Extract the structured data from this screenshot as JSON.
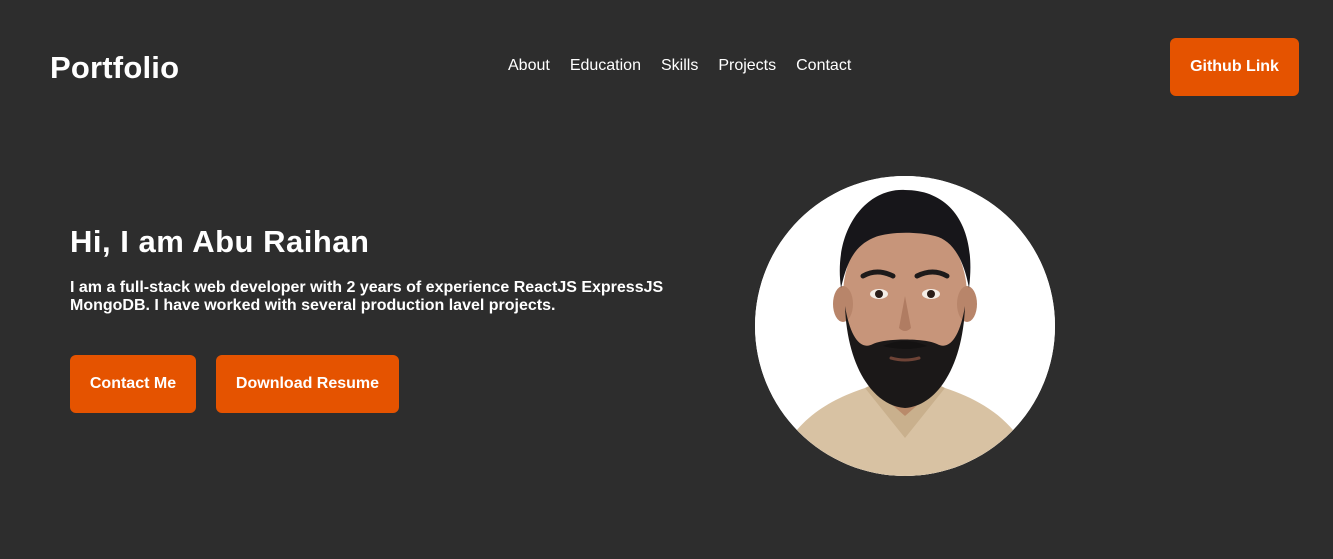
{
  "header": {
    "brand": "Portfolio",
    "nav": [
      {
        "label": "About"
      },
      {
        "label": "Education"
      },
      {
        "label": "Skills"
      },
      {
        "label": "Projects"
      },
      {
        "label": "Contact"
      }
    ],
    "github_label": "Github Link"
  },
  "hero": {
    "title": "Hi, I am Abu Raihan",
    "description": "I am a full-stack web developer with 2 years of experience ReactJS ExpressJS MongoDB. I have worked with several production lavel projects.",
    "contact_label": "Contact Me",
    "resume_label": "Download Resume"
  },
  "profile_photo": {
    "shape": "circle"
  },
  "colors": {
    "background": "#2d2d2d",
    "accent": "#e55300",
    "text": "#ffffff"
  }
}
